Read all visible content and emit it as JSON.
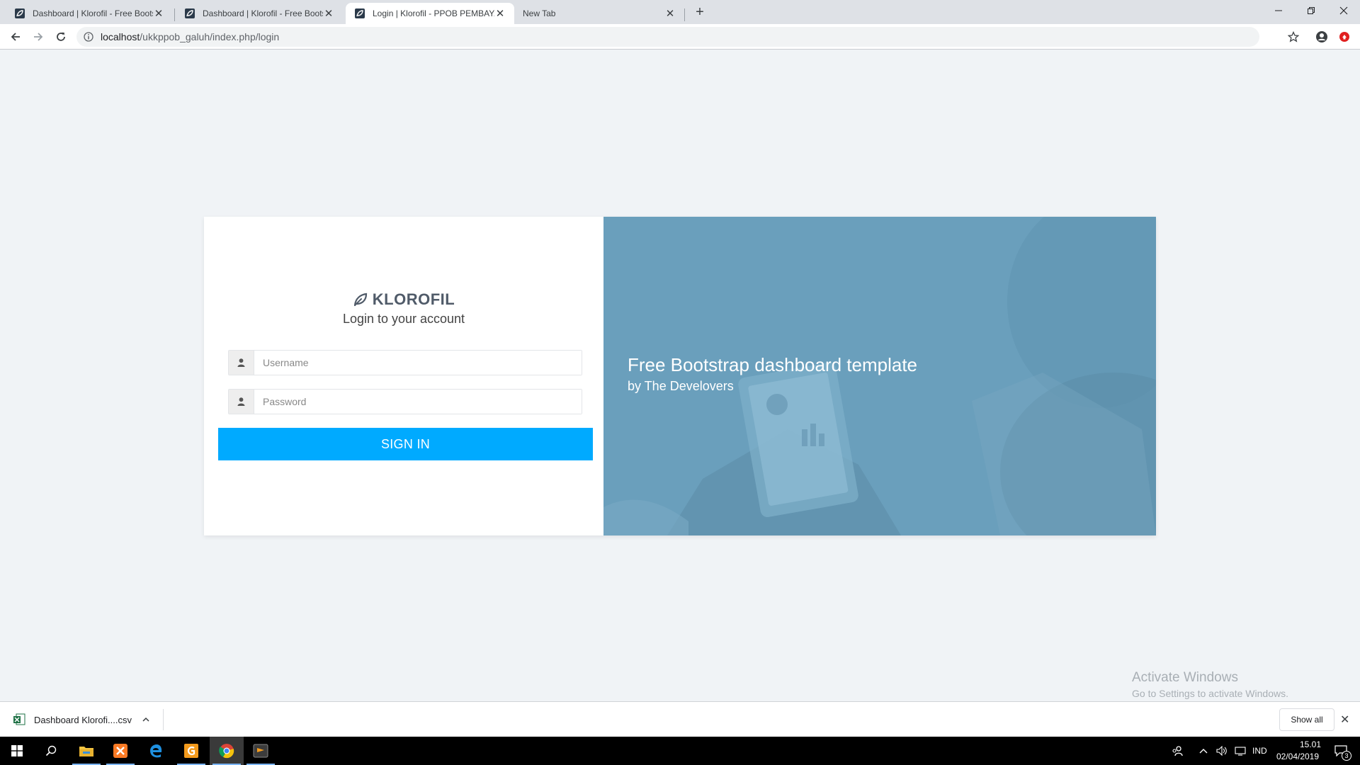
{
  "browser": {
    "tabs": [
      {
        "title": "Dashboard | Klorofil - Free Bootstrap",
        "active": false
      },
      {
        "title": "Dashboard | Klorofil - Free Bootstrap",
        "active": false
      },
      {
        "title": "Login | Klorofil - PPOB PEMBAYARAN",
        "active": true
      },
      {
        "title": "New Tab",
        "active": false
      }
    ],
    "address": {
      "host": "localhost",
      "path": "/ukkppob_galuh/index.php/login"
    }
  },
  "login": {
    "brand": "KLOROFIL",
    "lead": "Login to your account",
    "username_placeholder": "Username",
    "password_placeholder": "Password",
    "signin_label": "SIGN IN"
  },
  "hero": {
    "title": "Free Bootstrap dashboard template",
    "subtitle": "by The Develovers"
  },
  "watermark": {
    "line1": "Activate Windows",
    "line2": "Go to Settings to activate Windows."
  },
  "downloads": {
    "file": "Dashboard  Klorofi....csv",
    "show_all": "Show all"
  },
  "taskbar": {
    "language": "IND",
    "time": "15.01",
    "date": "02/04/2019",
    "notifications": "3"
  },
  "colors": {
    "accent": "#00aaff",
    "hero_bg": "#6a9fbc",
    "page_bg": "#f0f3f6"
  }
}
